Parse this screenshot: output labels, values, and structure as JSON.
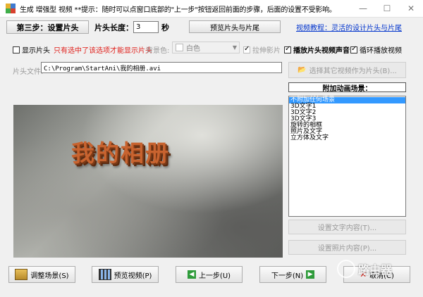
{
  "window": {
    "title": "生成 增强型 视频  **提示：随时可以点窗口底部的\"上一步\"按钮返回前面的步骤，后面的设置不受影响。",
    "minimize": "—",
    "maximize": "☐",
    "close": "✕"
  },
  "toolbar": {
    "step_label": "第三步：设置片头",
    "duration_label": "片头长度：",
    "duration_value": "3",
    "duration_unit": "秒",
    "preview_button": "预览片头与片尾",
    "tutorial_link": "视频教程：灵活的设计片头与片尾"
  },
  "options": {
    "show_intro": "显示片头",
    "show_intro_checked": false,
    "hint": "只有选中了该选项才能显示片头",
    "bg_color_label": "背景色:",
    "bg_color_value": "白色",
    "stretch_image": "拉伸影片",
    "stretch_image_checked": true,
    "play_intro_audio": "播放片头视频声音",
    "play_intro_audio_checked": true,
    "loop_video": "循环播放视频",
    "loop_video_checked": true
  },
  "file": {
    "label": "片头文件:",
    "path": "C:\\Program\\StartAni\\我的相册.avi",
    "choose_button": "选择其它视频作为片头(B)..."
  },
  "preview": {
    "title_text": "我的相册"
  },
  "animations": {
    "header": "附加动画场景：",
    "items": [
      "不附加任何场景",
      "3D文字1",
      "3D文字2",
      "3D文字3",
      "旋转的相框",
      "照片及文字",
      "立方体及文字"
    ],
    "selected_index": 0,
    "set_text_button": "设置文字内容(T)...",
    "set_photo_button": "设置照片内容(P)..."
  },
  "footer": {
    "adjust_scene": "调整场景(S)",
    "preview_video": "预览视频(P)",
    "prev_step": "上一步(U)",
    "next_step": "下一步(N)",
    "cancel": "取消(C)"
  },
  "watermark": {
    "text": "路由器"
  },
  "colors": {
    "hint_red": "#e0201b",
    "link_blue": "#0033cc",
    "selection": "#3399ff"
  }
}
